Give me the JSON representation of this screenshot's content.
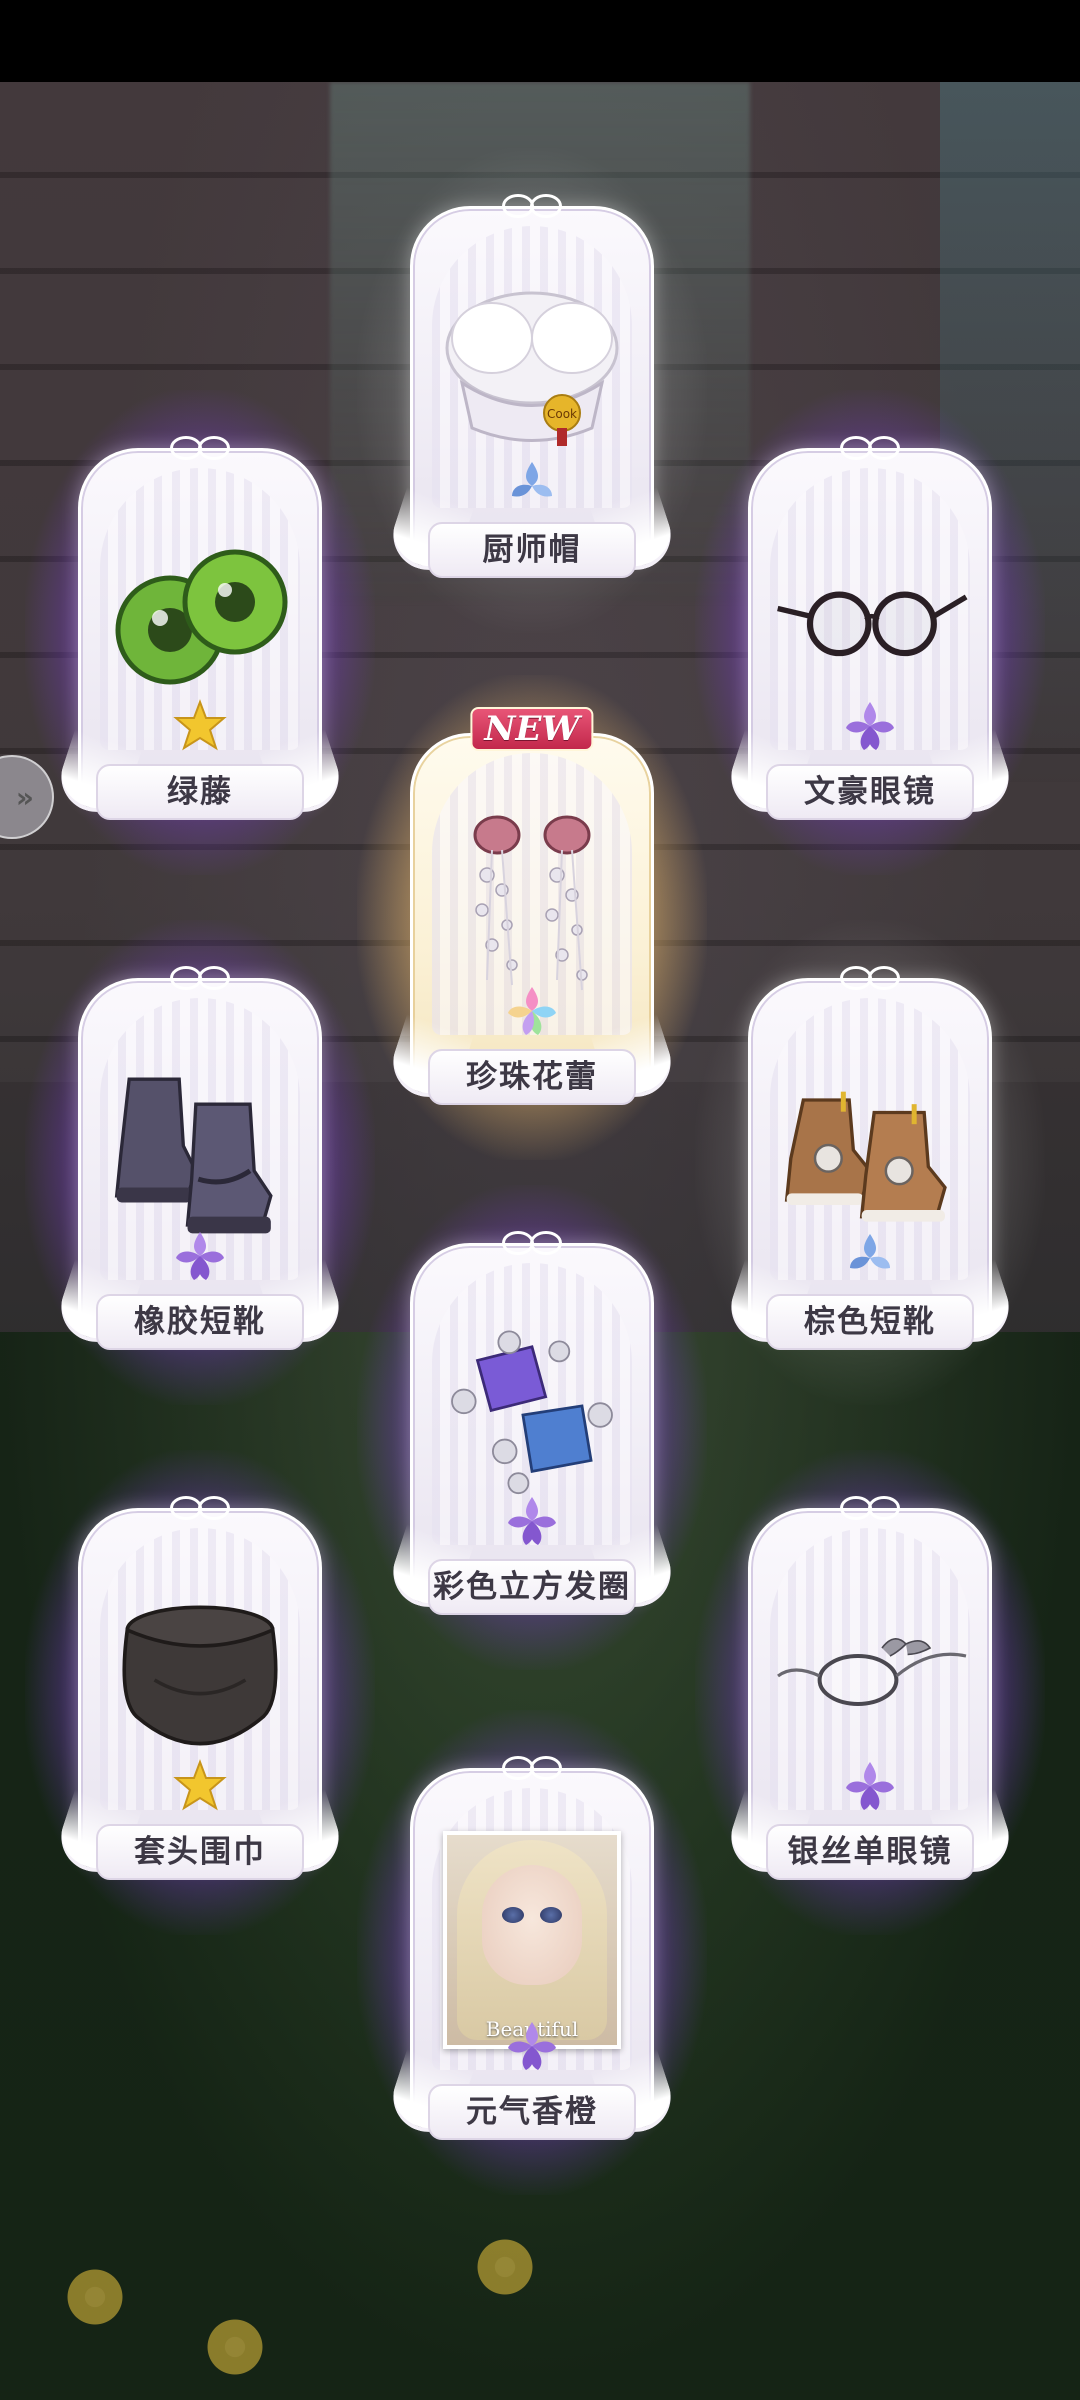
{
  "cards": [
    {
      "name": "厨师帽",
      "item_icon": "chef-hat-icon",
      "star_icon": "blue-flower-icon",
      "rarity_color": "#8fb6e8",
      "badge": ""
    },
    {
      "name": "绿藤",
      "item_icon": "green-eyes-icon",
      "star_icon": "gold-star-icon",
      "rarity_color": "#f2c62e",
      "badge": ""
    },
    {
      "name": "文豪眼镜",
      "item_icon": "round-glasses-icon",
      "star_icon": "purple-flower-icon",
      "rarity_color": "#a679e0",
      "badge": ""
    },
    {
      "name": "珍珠花蕾",
      "item_icon": "pearl-bud-earrings-icon",
      "star_icon": "rainbow-flower-icon",
      "rarity_color": "#f0a6d8",
      "badge": "NEW"
    },
    {
      "name": "橡胶短靴",
      "item_icon": "rubber-boots-icon",
      "star_icon": "purple-flower-icon",
      "rarity_color": "#a679e0",
      "badge": ""
    },
    {
      "name": "棕色短靴",
      "item_icon": "brown-boots-icon",
      "star_icon": "blue-flower-icon",
      "rarity_color": "#8fb6e8",
      "badge": ""
    },
    {
      "name": "彩色立方发圈",
      "item_icon": "cube-hair-tie-icon",
      "star_icon": "purple-flower-icon",
      "rarity_color": "#a679e0",
      "badge": ""
    },
    {
      "name": "套头围巾",
      "item_icon": "scarf-icon",
      "star_icon": "gold-star-icon",
      "rarity_color": "#f2c62e",
      "badge": ""
    },
    {
      "name": "银丝单眼镜",
      "item_icon": "silver-monocle-icon",
      "star_icon": "purple-flower-icon",
      "rarity_color": "#a679e0",
      "badge": ""
    },
    {
      "name": "元气香橙",
      "item_icon": "portrait-photo-icon",
      "star_icon": "purple-flower-icon",
      "rarity_color": "#a679e0",
      "badge": "",
      "photo_caption": "Beautiful"
    }
  ],
  "side_handle_icon": "chevron-right-icon"
}
